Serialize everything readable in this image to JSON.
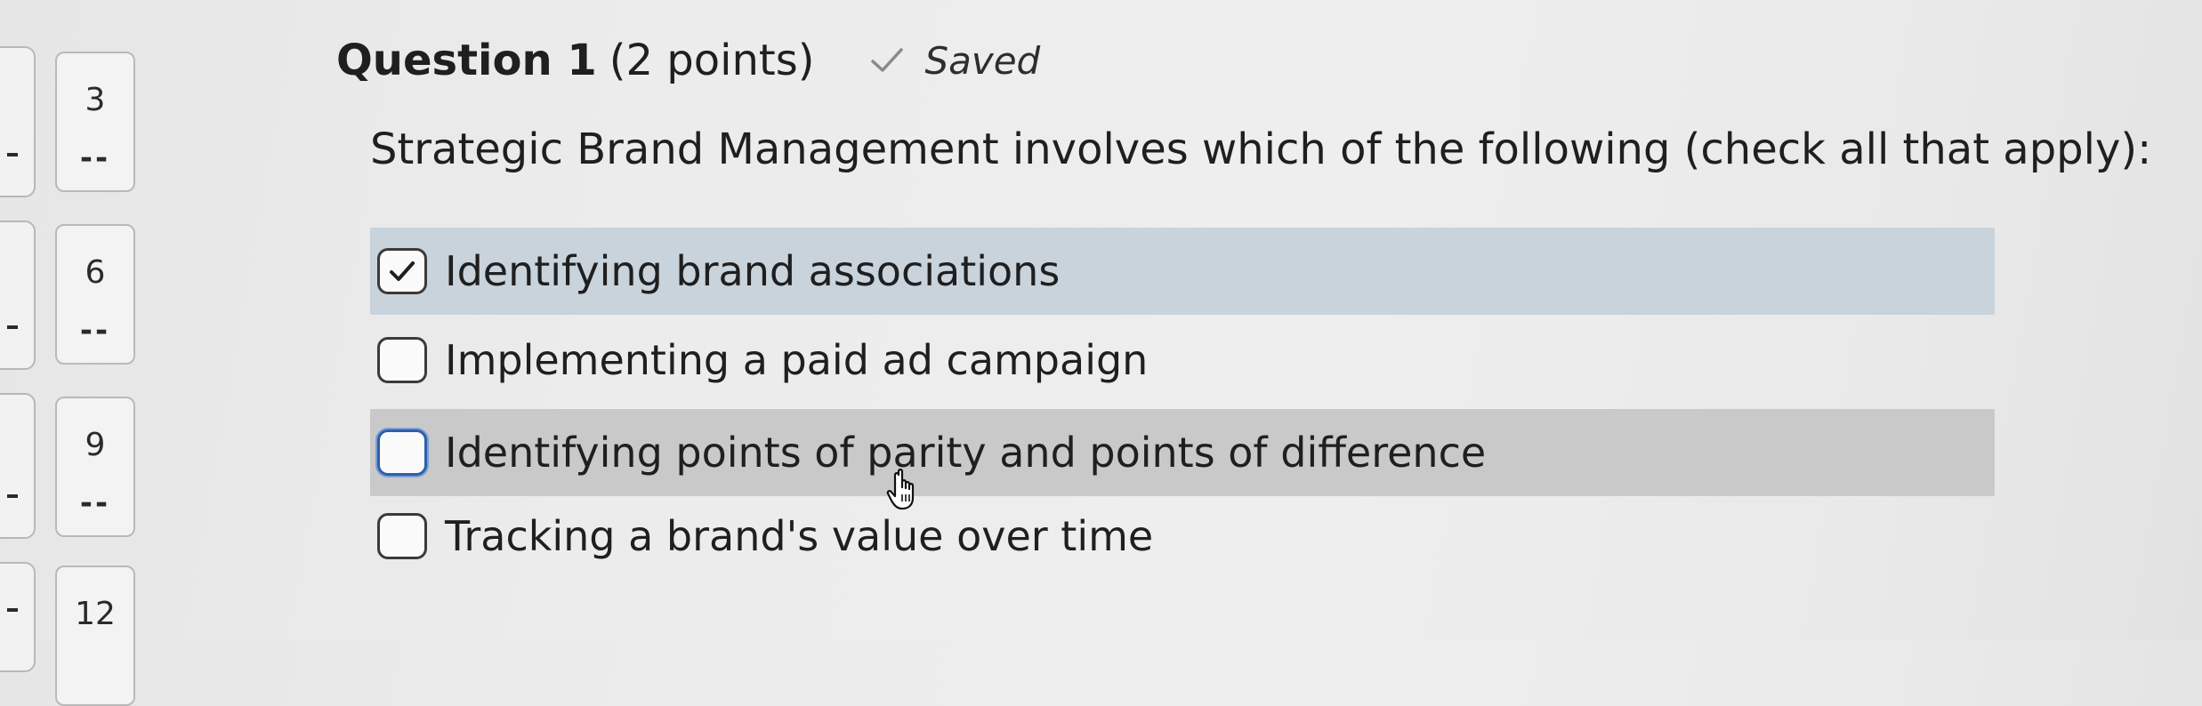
{
  "nav": {
    "items": [
      {
        "number": "3",
        "status": "--"
      },
      {
        "number": "6",
        "status": "--"
      },
      {
        "number": "9",
        "status": "--"
      },
      {
        "number": "12",
        "status": ""
      }
    ]
  },
  "question": {
    "title": "Question 1",
    "points": "(2 points)",
    "save_status": "Saved",
    "save_icon": "checkmark-icon",
    "prompt": "Strategic Brand Management involves which of the following (check all that apply):"
  },
  "options": [
    {
      "label": "Identifying brand associations",
      "checked": true
    },
    {
      "label": "Implementing a paid ad campaign",
      "checked": false
    },
    {
      "label": "Identifying points of parity and points of difference",
      "checked": false
    },
    {
      "label": "Tracking a brand's value over time",
      "checked": false
    }
  ],
  "colors": {
    "selected_row": "#c9d3dc",
    "hover_row": "#c9c9c9",
    "focus_border": "#2f5fa8"
  }
}
